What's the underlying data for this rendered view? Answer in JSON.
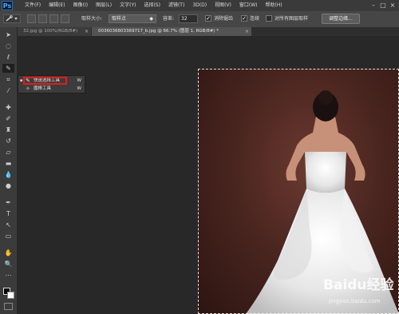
{
  "app": {
    "logo": "Ps"
  },
  "menu": {
    "items": [
      "文件(F)",
      "编辑(E)",
      "图像(I)",
      "图层(L)",
      "文字(Y)",
      "选择(S)",
      "滤镜(T)",
      "3D(D)",
      "视图(V)",
      "窗口(W)",
      "帮助(H)"
    ]
  },
  "window_controls": {
    "minimize": "–",
    "maximize": "□",
    "close": "×"
  },
  "options": {
    "sample_size_label": "取样大小:",
    "sample_size_value": "取样点",
    "tolerance_label": "容差:",
    "tolerance_value": "32",
    "antialias_label": "消除锯齿",
    "antialias_checked": "✓",
    "contiguous_label": "连续",
    "contiguous_checked": "✓",
    "all_layers_label": "对所有图层取样",
    "refine_edge_label": "调整边缘..."
  },
  "tabs": [
    {
      "label": "32.jpg @ 100%(RGB/8#)",
      "close": "×"
    },
    {
      "label": "0036036803369717_b.jpg @ 66.7% (图层 1, RGB/8#) *",
      "close": "×"
    }
  ],
  "flyout": {
    "items": [
      {
        "label": "快速选择工具",
        "shortcut": "W",
        "icon": "✎"
      },
      {
        "label": "魔棒工具",
        "shortcut": "W",
        "icon": "✧"
      }
    ],
    "current_marker": "▪"
  },
  "colors": {
    "foreground": "#000000",
    "background": "#ffffff",
    "highlight": "#e8191c"
  },
  "watermark": {
    "main": "Baidu经验",
    "sub": "jingyan.baidu.com"
  }
}
